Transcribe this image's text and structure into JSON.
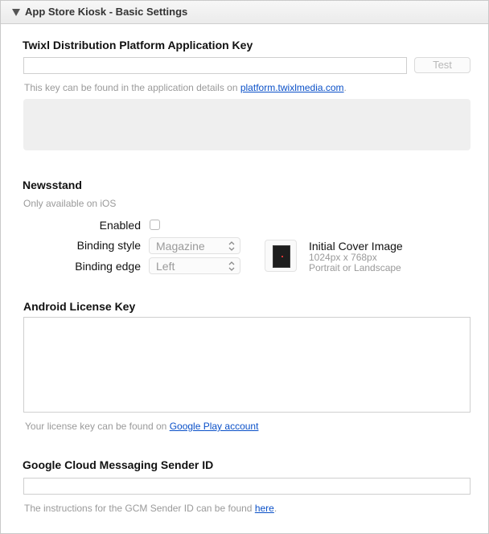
{
  "panel": {
    "title": "App Store Kiosk - Basic Settings"
  },
  "twixl": {
    "heading": "Twixl Distribution Platform Application Key",
    "key_value": "",
    "test_button": "Test",
    "hint_prefix": "This key can be found in the application details on ",
    "hint_link": "platform.twixlmedia.com",
    "hint_suffix": "."
  },
  "newsstand": {
    "heading": "Newsstand",
    "note": "Only available on iOS",
    "enabled_label": "Enabled",
    "enabled_checked": false,
    "binding_style_label": "Binding style",
    "binding_style_value": "Magazine",
    "binding_edge_label": "Binding edge",
    "binding_edge_value": "Left",
    "cover_title": "Initial Cover Image",
    "cover_size": "1024px x 768px",
    "cover_orientation": "Portrait or Landscape"
  },
  "android": {
    "heading": "Android License Key",
    "key_value": "",
    "hint_prefix": "Your license key can be found on ",
    "hint_link": "Google Play account"
  },
  "gcm": {
    "heading": "Google Cloud Messaging Sender ID",
    "value": "",
    "hint_prefix": "The instructions for the GCM Sender ID can be found ",
    "hint_link": "here",
    "hint_suffix": "."
  }
}
